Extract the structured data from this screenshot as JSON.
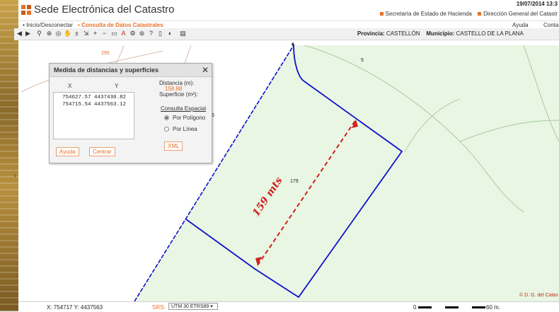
{
  "header": {
    "title": "Sede Electrónica del Catastro",
    "date": "19/07/2014 13:3",
    "links": [
      "Secretaría de Estado de Hacienda",
      "Dirección General del Catastr"
    ]
  },
  "menu": {
    "login": "Inicio/Desconectar",
    "consulta": "Consulta de Datos Catastrales",
    "ayuda": "Ayuda",
    "contacto": "Conta"
  },
  "location": {
    "provincia_label": "Provincia:",
    "provincia": "CASTELLÓN",
    "municipio_label": "Municipio:",
    "municipio": "CASTELLO DE LA PLANA"
  },
  "dialog": {
    "title": "Medida de distancias y superficies",
    "col_x": "X",
    "col_y": "Y",
    "coords": [
      "754627.57 4437430.82",
      "754715.54 4437563.12"
    ],
    "distancia_label": "Distancia (m):",
    "distancia_value": "158.88",
    "superficie_label": "Superficie (m²):",
    "consulta_label": "Consulta Espacial",
    "radio_poligono": "Por Polígono",
    "radio_linea": "Por Línea",
    "selected": "Por Polígono",
    "xml_button": "XML",
    "ayuda_button": "Ayuda",
    "centrar_button": "Centrar"
  },
  "map": {
    "parcel_labels": [
      "295",
      "5",
      "179",
      "6"
    ],
    "annotation": "159 mts",
    "copyright": "© D. G. del Catas"
  },
  "status": {
    "xy": "X: 754717 Y: 4437563",
    "srs_label": "SRS:",
    "srs_value": "UTM 30 ETRS89",
    "scale_zero": "0",
    "scale_label": "60 m."
  },
  "colors": {
    "accent": "#e8702a",
    "parcel_fill": "#e8f6e3",
    "parcel_border": "#1010c8",
    "measure": "#d02020"
  }
}
